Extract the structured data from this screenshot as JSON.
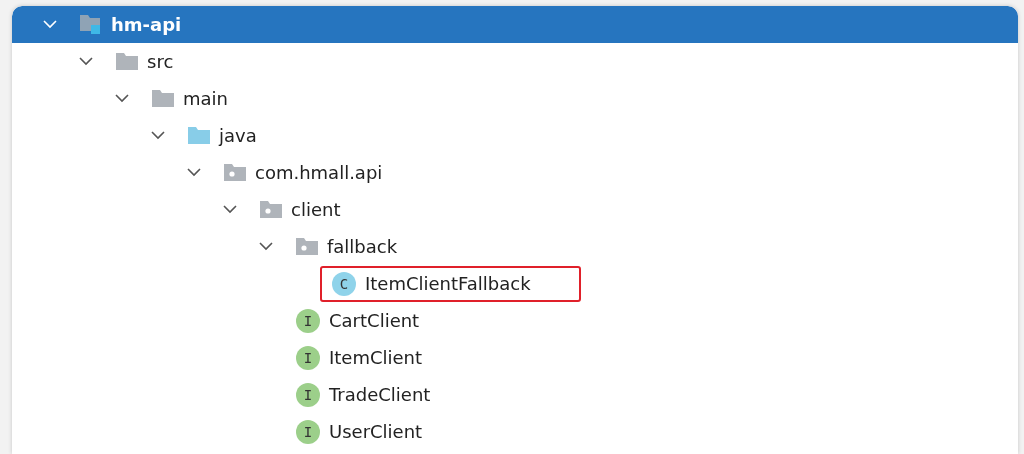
{
  "tree": [
    {
      "label": "hm-api",
      "kind": "module",
      "expanded": true,
      "selected": true,
      "highlighted": false,
      "children": [
        {
          "label": "src",
          "kind": "folder",
          "expanded": true,
          "selected": false,
          "highlighted": false,
          "children": [
            {
              "label": "main",
              "kind": "folder",
              "expanded": true,
              "selected": false,
              "highlighted": false,
              "children": [
                {
                  "label": "java",
                  "kind": "source",
                  "expanded": true,
                  "selected": false,
                  "highlighted": false,
                  "children": [
                    {
                      "label": "com.hmall.api",
                      "kind": "package",
                      "expanded": true,
                      "selected": false,
                      "highlighted": false,
                      "children": [
                        {
                          "label": "client",
                          "kind": "package",
                          "expanded": true,
                          "selected": false,
                          "highlighted": false,
                          "children": [
                            {
                              "label": "fallback",
                              "kind": "package",
                              "expanded": true,
                              "selected": false,
                              "highlighted": false,
                              "children": [
                                {
                                  "label": "ItemClientFallback",
                                  "kind": "class",
                                  "badge": "C",
                                  "selected": false,
                                  "highlighted": true
                                }
                              ]
                            },
                            {
                              "label": "CartClient",
                              "kind": "interface",
                              "badge": "I",
                              "selected": false,
                              "highlighted": false
                            },
                            {
                              "label": "ItemClient",
                              "kind": "interface",
                              "badge": "I",
                              "selected": false,
                              "highlighted": false
                            },
                            {
                              "label": "TradeClient",
                              "kind": "interface",
                              "badge": "I",
                              "selected": false,
                              "highlighted": false
                            },
                            {
                              "label": "UserClient",
                              "kind": "interface",
                              "badge": "I",
                              "selected": false,
                              "highlighted": false
                            }
                          ]
                        }
                      ]
                    }
                  ]
                }
              ]
            }
          ]
        }
      ]
    }
  ]
}
